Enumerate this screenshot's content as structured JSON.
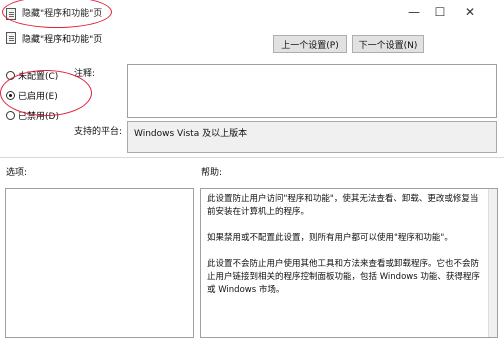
{
  "window": {
    "title": "隐藏\"程序和功能\"页",
    "minimize_glyph": "—",
    "maximize_glyph": "☐",
    "close_glyph": "✕"
  },
  "header": {
    "policy_name": "隐藏\"程序和功能\"页",
    "prev_button": "上一个设置(P)",
    "next_button": "下一个设置(N)"
  },
  "state": {
    "options": [
      {
        "label": "未配置(C)",
        "checked": false
      },
      {
        "label": "已启用(E)",
        "checked": true
      },
      {
        "label": "已禁用(D)",
        "checked": false
      }
    ]
  },
  "comment": {
    "label": "注释:",
    "value": ""
  },
  "platform": {
    "label": "支持的平台:",
    "value": "Windows Vista 及以上版本"
  },
  "options_panel": {
    "label": "选项:"
  },
  "help": {
    "label": "帮助:",
    "paragraphs": [
      "此设置防止用户访问\"程序和功能\"，使其无法查看、卸载、更改或修复当前安装在计算机上的程序。",
      "如果禁用或不配置此设置，则所有用户都可以使用\"程序和功能\"。",
      "此设置不会防止用户使用其他工具和方法来查看或卸载程序。它也不会防止用户链接到相关的程序控制面板功能，包括 Windows 功能、获得程序或 Windows 市场。"
    ]
  },
  "colors": {
    "annotation": "#e0203a",
    "button_bg": "#e1e1e1",
    "platform_bg": "#f0f0f0"
  }
}
